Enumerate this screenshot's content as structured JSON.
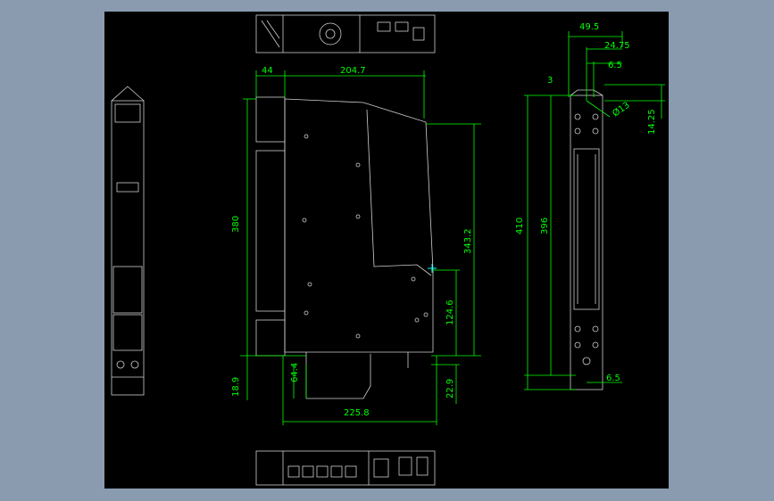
{
  "colors": {
    "background": "#8a9bb0",
    "viewport": "#000000",
    "dimension": "#00ff00",
    "geometry": "#cfcfcf"
  },
  "dimensions": {
    "top_width": "49.5",
    "top_24_75": "24.75",
    "top_6_5": "6.5",
    "left_3": "3",
    "hole_dia": "Ø13",
    "right_14_25": "14.25",
    "height_410": "410",
    "height_396": "396",
    "bottom_6_5": "6.5",
    "front_44": "44",
    "front_204_7": "204.7",
    "front_380": "380",
    "front_343_2": "343.2",
    "front_124_6": "124.6",
    "front_18_9": "18.9",
    "front_64_4": "64.4",
    "front_22_9": "22.9",
    "front_225_8": "225.8"
  }
}
